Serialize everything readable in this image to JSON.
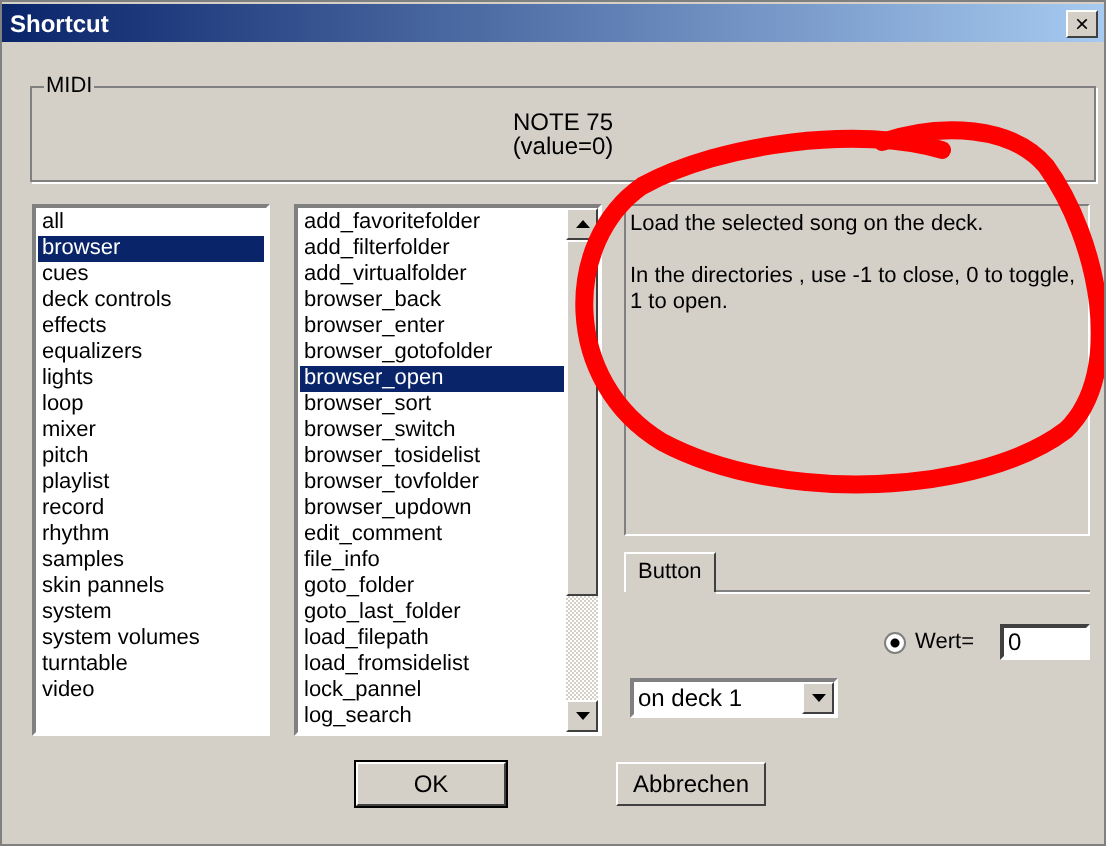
{
  "window": {
    "title": "Shortcut",
    "close": "×"
  },
  "midi": {
    "legend": "MIDI",
    "note": "NOTE 75",
    "value": "(value=0)"
  },
  "categories": [
    {
      "label": "all",
      "selected": false
    },
    {
      "label": "browser",
      "selected": true
    },
    {
      "label": "cues",
      "selected": false
    },
    {
      "label": "deck controls",
      "selected": false
    },
    {
      "label": "effects",
      "selected": false
    },
    {
      "label": "equalizers",
      "selected": false
    },
    {
      "label": "lights",
      "selected": false
    },
    {
      "label": "loop",
      "selected": false
    },
    {
      "label": "mixer",
      "selected": false
    },
    {
      "label": "pitch",
      "selected": false
    },
    {
      "label": "playlist",
      "selected": false
    },
    {
      "label": "record",
      "selected": false
    },
    {
      "label": "rhythm",
      "selected": false
    },
    {
      "label": "samples",
      "selected": false
    },
    {
      "label": "skin pannels",
      "selected": false
    },
    {
      "label": "system",
      "selected": false
    },
    {
      "label": "system volumes",
      "selected": false
    },
    {
      "label": "turntable",
      "selected": false
    },
    {
      "label": "video",
      "selected": false
    }
  ],
  "actions": [
    {
      "label": "add_favoritefolder",
      "selected": false
    },
    {
      "label": "add_filterfolder",
      "selected": false
    },
    {
      "label": "add_virtualfolder",
      "selected": false
    },
    {
      "label": "browser_back",
      "selected": false
    },
    {
      "label": "browser_enter",
      "selected": false
    },
    {
      "label": "browser_gotofolder",
      "selected": false
    },
    {
      "label": "browser_open",
      "selected": true
    },
    {
      "label": "browser_sort",
      "selected": false
    },
    {
      "label": "browser_switch",
      "selected": false
    },
    {
      "label": "browser_tosidelist",
      "selected": false
    },
    {
      "label": "browser_tovfolder",
      "selected": false
    },
    {
      "label": "browser_updown",
      "selected": false
    },
    {
      "label": "edit_comment",
      "selected": false
    },
    {
      "label": "file_info",
      "selected": false
    },
    {
      "label": "goto_folder",
      "selected": false
    },
    {
      "label": "goto_last_folder",
      "selected": false
    },
    {
      "label": "load_filepath",
      "selected": false
    },
    {
      "label": "load_fromsidelist",
      "selected": false
    },
    {
      "label": "lock_pannel",
      "selected": false
    },
    {
      "label": "log_search",
      "selected": false
    }
  ],
  "description": [
    "Load the selected song on the deck.",
    " In the directories , use -1 to close, 0 to toggle, 1 to open."
  ],
  "tabs": [
    {
      "label": "Button",
      "selected": true
    }
  ],
  "radio": {
    "label": "Wert=",
    "checked": true
  },
  "value_field": {
    "value": "0"
  },
  "deck_dropdown": {
    "value": "on deck 1"
  },
  "buttons": [
    {
      "label": "OK"
    },
    {
      "label": "Abbrechen"
    }
  ]
}
